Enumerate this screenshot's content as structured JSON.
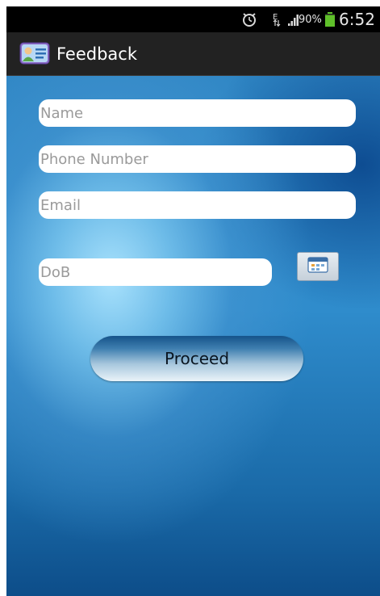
{
  "status_bar": {
    "battery_percent": "90%",
    "time": "6:52 PM",
    "battery_level": 0.9,
    "icons": [
      "alarm-icon",
      "data-transfer-icon",
      "signal-icon",
      "battery-icon"
    ]
  },
  "action_bar": {
    "title": "Feedback",
    "icon": "contact-card-icon"
  },
  "form": {
    "name_placeholder": "Name",
    "phone_placeholder": "Phone Number",
    "email_placeholder": "Email",
    "dob_placeholder": "DoB",
    "calendar_button_icon": "calendar-icon",
    "proceed_label": "Proceed"
  },
  "colors": {
    "status_bar_bg": "#000000",
    "action_bar_bg": "#222222",
    "battery_green": "#5fc02a",
    "content_light": "#b0e4ff",
    "content_dark": "#0d4d89"
  }
}
